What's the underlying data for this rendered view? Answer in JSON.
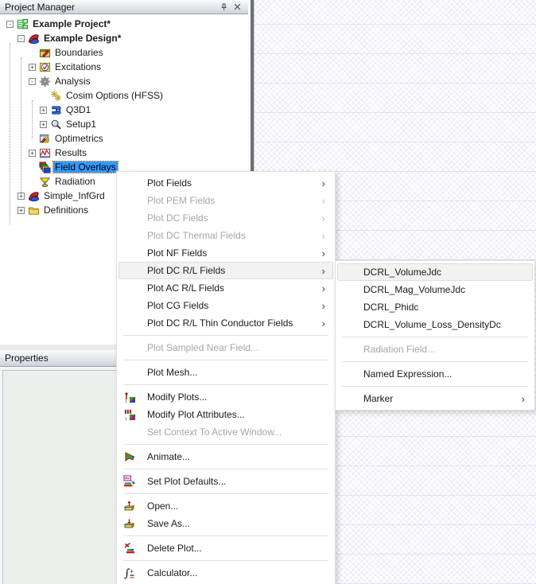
{
  "project_manager": {
    "title": "Project Manager",
    "tree": [
      {
        "label": "Example Project*",
        "level": 0,
        "box": "minus",
        "icon": "project",
        "bold": true
      },
      {
        "label": "Example Design*",
        "level": 1,
        "box": "minus",
        "icon": "design",
        "bold": true
      },
      {
        "label": "Boundaries",
        "level": 2,
        "box": null,
        "icon": "boundaries"
      },
      {
        "label": "Excitations",
        "level": 2,
        "box": "plus",
        "icon": "excitations"
      },
      {
        "label": "Analysis",
        "level": 2,
        "box": "minus",
        "icon": "analysis-gear"
      },
      {
        "label": "Cosim Options (HFSS)",
        "level": 3,
        "box": null,
        "icon": "cosim-gears"
      },
      {
        "label": "Q3D1",
        "level": 3,
        "box": "plus",
        "icon": "q3d"
      },
      {
        "label": "Setup1",
        "level": 3,
        "box": "plus",
        "icon": "setup-magnifier"
      },
      {
        "label": "Optimetrics",
        "level": 2,
        "box": null,
        "icon": "optimetrics"
      },
      {
        "label": "Results",
        "level": 2,
        "box": "plus",
        "icon": "results"
      },
      {
        "label": "Field Overlays",
        "level": 2,
        "box": null,
        "icon": "field-overlays",
        "selected": true
      },
      {
        "label": "Radiation",
        "level": 2,
        "box": null,
        "icon": "radiation"
      },
      {
        "label": "Simple_InfGrd",
        "level": 1,
        "box": "plus",
        "icon": "design"
      },
      {
        "label": "Definitions",
        "level": 1,
        "box": "plus",
        "icon": "folder"
      }
    ]
  },
  "properties_panel": {
    "title": "Properties"
  },
  "context_menu": {
    "items": [
      {
        "type": "item",
        "label": "Plot Fields",
        "enabled": true,
        "submenu": true
      },
      {
        "type": "item",
        "label": "Plot PEM Fields",
        "enabled": false,
        "submenu": true
      },
      {
        "type": "item",
        "label": "Plot DC Fields",
        "enabled": false,
        "submenu": true
      },
      {
        "type": "item",
        "label": "Plot DC Thermal Fields",
        "enabled": false,
        "submenu": true
      },
      {
        "type": "item",
        "label": "Plot NF Fields",
        "enabled": true,
        "submenu": true
      },
      {
        "type": "item",
        "label": "Plot DC R/L Fields",
        "enabled": true,
        "submenu": true,
        "highlighted": true
      },
      {
        "type": "item",
        "label": "Plot AC R/L Fields",
        "enabled": true,
        "submenu": true
      },
      {
        "type": "item",
        "label": "Plot CG Fields",
        "enabled": true,
        "submenu": true
      },
      {
        "type": "item",
        "label": "Plot DC R/L Thin Conductor Fields",
        "enabled": true,
        "submenu": true
      },
      {
        "type": "separator"
      },
      {
        "type": "item",
        "label": "Plot Sampled Near Field...",
        "enabled": false
      },
      {
        "type": "separator"
      },
      {
        "type": "item",
        "label": "Plot Mesh...",
        "enabled": true
      },
      {
        "type": "separator"
      },
      {
        "type": "item",
        "label": "Modify Plots...",
        "enabled": true,
        "icon": "modify-plots"
      },
      {
        "type": "item",
        "label": "Modify Plot Attributes...",
        "enabled": true,
        "icon": "modify-plot-attributes"
      },
      {
        "type": "item",
        "label": "Set Context To Active Window...",
        "enabled": false
      },
      {
        "type": "separator"
      },
      {
        "type": "item",
        "label": "Animate...",
        "enabled": true,
        "icon": "animate"
      },
      {
        "type": "separator"
      },
      {
        "type": "item",
        "label": "Set Plot Defaults...",
        "enabled": true,
        "icon": "set-plot-defaults"
      },
      {
        "type": "separator"
      },
      {
        "type": "item",
        "label": "Open...",
        "enabled": true,
        "icon": "open"
      },
      {
        "type": "item",
        "label": "Save As...",
        "enabled": true,
        "icon": "save-as"
      },
      {
        "type": "separator"
      },
      {
        "type": "item",
        "label": "Delete Plot...",
        "enabled": true,
        "icon": "delete-plot"
      },
      {
        "type": "separator"
      },
      {
        "type": "item",
        "label": "Calculator...",
        "enabled": true,
        "icon": "calculator"
      }
    ]
  },
  "submenu": {
    "items": [
      {
        "type": "item",
        "label": "DCRL_VolumeJdc",
        "enabled": true,
        "highlighted": true
      },
      {
        "type": "item",
        "label": "DCRL_Mag_VolumeJdc",
        "enabled": true
      },
      {
        "type": "item",
        "label": "DCRL_Phidc",
        "enabled": true
      },
      {
        "type": "item",
        "label": "DCRL_Volume_Loss_DensityDc",
        "enabled": true
      },
      {
        "type": "separator"
      },
      {
        "type": "item",
        "label": "Radiation Field...",
        "enabled": false
      },
      {
        "type": "separator"
      },
      {
        "type": "item",
        "label": "Named Expression...",
        "enabled": true
      },
      {
        "type": "separator"
      },
      {
        "type": "item",
        "label": "Marker",
        "enabled": true,
        "submenu": true
      }
    ]
  },
  "colors": {
    "selection_blue": "#3399ff",
    "menu_highlight": "#f2f2f0",
    "disabled_text": "#a6a6a6",
    "titlebar_text": "#14141c"
  }
}
